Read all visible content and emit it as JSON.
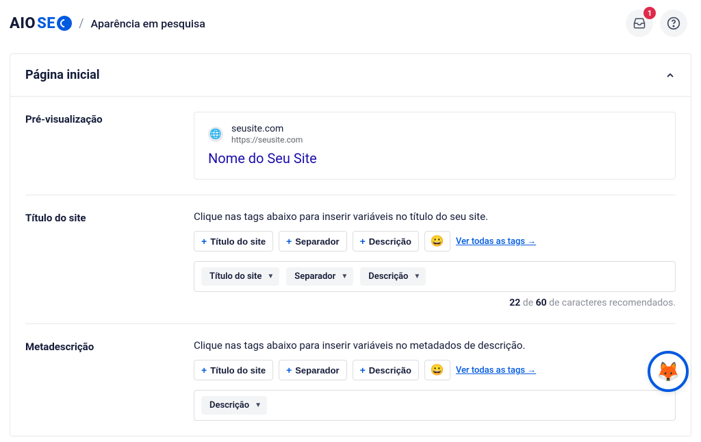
{
  "header": {
    "logo_pre": "AIO",
    "logo_post": "SE",
    "page_title": "Aparência em pesquisa",
    "notification_count": "1"
  },
  "card": {
    "title": "Página inicial"
  },
  "preview": {
    "label": "Pré-visualização",
    "site": "seusite.com",
    "url": "https://seusite.com",
    "title": "Nome do Seu Site"
  },
  "site_title": {
    "label": "Título do site",
    "helper": "Clique nas tags abaixo para inserir variáveis no título do seu site.",
    "tag1": "Título do site",
    "tag2": "Separador",
    "tag3": "Descrição",
    "view_all": "Ver todas as tags →",
    "chip1": "Título do site",
    "chip2": "Separador",
    "chip3": "Descrição",
    "counter_current": "22",
    "counter_mid": " de ",
    "counter_max": "60",
    "counter_suffix": " de caracteres recomendados."
  },
  "meta": {
    "label": "Metadescrição",
    "helper": "Clique nas tags abaixo para inserir variáveis no metadados de descrição.",
    "tag1": "Título do site",
    "tag2": "Separador",
    "tag3": "Descrição",
    "view_all": "Ver todas as tags →",
    "chip1": "Descrição"
  }
}
